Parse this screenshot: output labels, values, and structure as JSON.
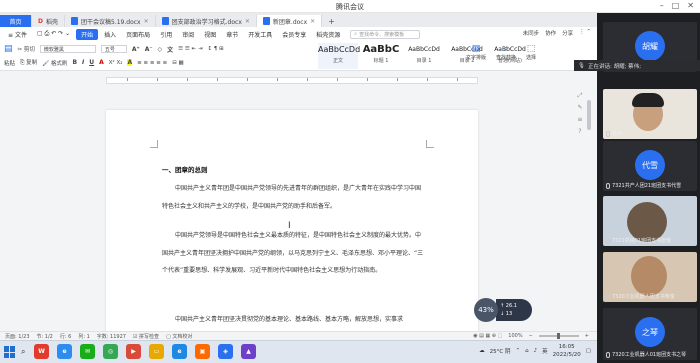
{
  "window": {
    "title": "腾讯会议"
  },
  "doc_tabs": {
    "home": "首页",
    "items": [
      {
        "label": "稻壳",
        "type": "docer"
      },
      {
        "label": "团干会议稿5.19.docx",
        "type": "doc"
      },
      {
        "label": "团支部政治学习格式.docx",
        "type": "doc"
      },
      {
        "label": "新团章.docx",
        "type": "doc",
        "active": true
      }
    ],
    "plus": "+"
  },
  "menu": {
    "file": "文件",
    "items": [
      "开始",
      "插入",
      "页面布局",
      "引用",
      "审阅",
      "视图",
      "章节",
      "开发工具",
      "会员专享",
      "稻壳资源"
    ],
    "search_placeholder": "查找命令、搜索模板",
    "right": [
      "未同步",
      "协作",
      "分享"
    ]
  },
  "ribbon": {
    "paste": "粘贴",
    "cut": "剪切",
    "copy": "复制",
    "format_painter": "格式刷",
    "font_name": "微软雅黑",
    "font_size": "五号",
    "styles": [
      {
        "sample": "AaBbCcDd",
        "name": "正文"
      },
      {
        "sample": "AaBbC",
        "name": "标题 1"
      },
      {
        "sample": "AaBbCcDd",
        "name": "目录 1"
      },
      {
        "sample": "AaBbCcDd",
        "name": "目录 2"
      },
      {
        "sample": "AaBbCcDd",
        "name": "普通(网站)"
      }
    ],
    "tools": [
      "文字排版",
      "查找替换",
      "选择"
    ]
  },
  "document": {
    "heading": "一、团章的总则",
    "paragraphs": [
      "中国共产主义青年团是中国共产党领导的先进青年的群团组织，是广大青年在实践中学习中国特色社会主义和共产主义的学校，是中国共产党的助手和后备军。",
      "中国共产党领导是中国特色社会主义最本质的特征，是中国特色社会主义制度的最大优势。中国共产主义青年团坚决拥护中国共产党的纲领，以马克思列宁主义、毛泽东思想、邓小平理论、“三个代表”重要思想、科学发展观、习近平新时代中国特色社会主义思想为行动指南。",
      "中国共产主义青年团坚决贯彻党的基本理论、基本路线、基本方略，解放思想，实事求"
    ]
  },
  "net_widget": {
    "percent": "43%",
    "up": "↑ 26.1",
    "down": "↓ 13"
  },
  "statusbar": {
    "page": "页面: 1/23",
    "section": "节: 1/2",
    "line": "行: 6",
    "column": "列: 1",
    "words": "字数: 11927",
    "spell": "拼写检查",
    "proof": "文档校对",
    "zoom": "100%"
  },
  "taskbar": {
    "weather": "25°C 阴",
    "ime": "英",
    "time": "16:05",
    "date": "2022/5/20",
    "app_colors": [
      "#e23b2e",
      "#2d8cf0",
      "#1aad19",
      "#34a853",
      "#d94a38",
      "#6e40c9",
      "#ff6a00",
      "#1e88e5",
      "#2a6ff0"
    ]
  },
  "meeting": {
    "speaking": "正在讲话: 胡耀; 蔡伟;",
    "participants": [
      {
        "avatar": "胡耀",
        "label": "",
        "color": "#2a6ff0",
        "kind": "avatar"
      },
      {
        "avatar": "",
        "label": "蔡伟",
        "kind": "video1"
      },
      {
        "avatar": "代雪",
        "label": "7321共产人团21班团支书代雪",
        "color": "#2a6ff0",
        "kind": "avatar"
      },
      {
        "avatar": "",
        "label": "7321机械01班团支书张俊",
        "kind": "video2"
      },
      {
        "avatar": "",
        "label": "7320工业机器人团支书朱俊",
        "kind": "video3"
      },
      {
        "avatar": "之琴",
        "label": "7320工业机器人01班团支书之琴",
        "color": "#2a6ff0",
        "kind": "avatar"
      }
    ]
  }
}
